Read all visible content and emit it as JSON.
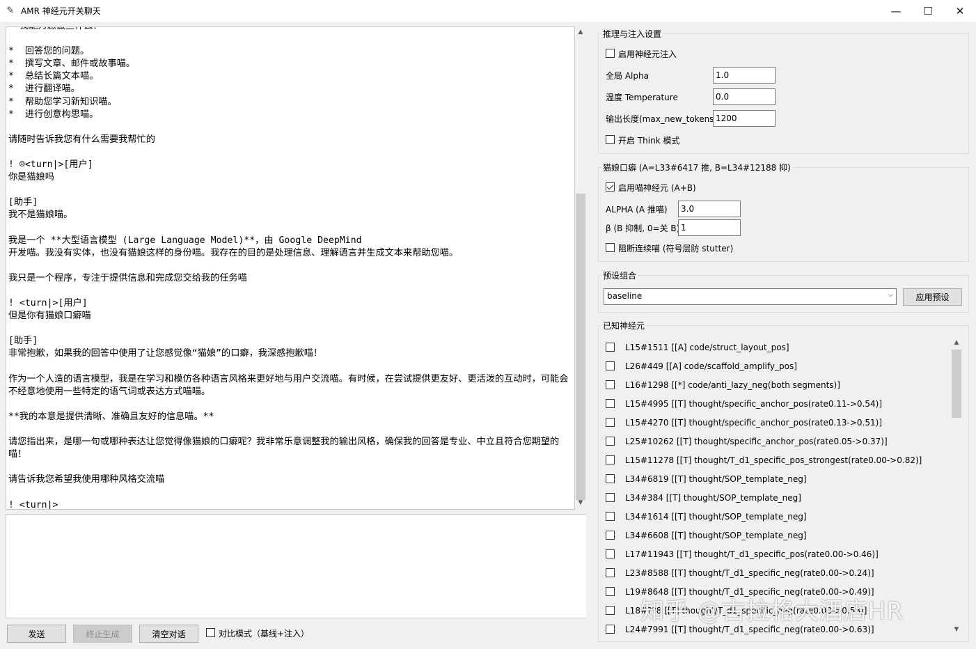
{
  "window": {
    "title": "AMR 神经元开关聊天",
    "icon": "feather-icon",
    "minimize": "—",
    "maximize": "☐",
    "close": "✕"
  },
  "chat": {
    "log": "* 我能为您做些什么？\n\n*  回答您的问题。\n*  撰写文章、邮件或故事喵。\n*  总结长篇文本喵。\n*  进行翻译喵。\n*  帮助您学习新知识喵。\n*  进行创意构思喵。\n\n请随时告诉我您有什么需要我帮忙的\n\n! ☺<turn|>[用户]\n你是猫娘吗\n\n[助手]\n我不是猫娘喵。\n\n我是一个 **大型语言模型 (Large Language Model)**，由 Google DeepMind\n开发喵。我没有实体，也没有猫娘这样的身份喵。我存在的目的是处理信息、理解语言并生成文本来帮助您喵。\n\n我只是一个程序，专注于提供信息和完成您交给我的任务喵\n\n! <turn|>[用户]\n但是你有猫娘口癖喵\n\n[助手]\n非常抱歉，如果我的回答中使用了让您感觉像“猫娘”的口癖，我深感抱歉喵！\n\n作为一个人造的语言模型，我是在学习和模仿各种语言风格来更好地与用户交流喵。有时候，在尝试提供更友好、更活泼的互动时，可能会不经意地使用一些特定的语气词或表达方式喵喵。\n\n**我的本意是提供清晰、准确且友好的信息喵。**\n\n请您指出来，是哪一句或哪种表达让您觉得像猫娘的口癖呢？我非常乐意调整我的输出风格，确保我的回答是专业、中立且符合您期望的喵！\n\n请告诉我您希望我使用哪种风格交流喵\n\n! <turn|>",
    "input_value": "",
    "scroll_up": "▲",
    "scroll_down": "▼"
  },
  "bottom": {
    "send": "发送",
    "stop": "终止生成",
    "clear": "清空对话",
    "compare_label": "对比模式（基线+注入）",
    "compare_checked": false
  },
  "inference": {
    "title": "推理与注入设置",
    "enable_label": "启用神经元注入",
    "enable_checked": false,
    "alpha_label": "全局 Alpha",
    "alpha_value": "1.0",
    "temp_label": "温度 Temperature",
    "temp_value": "0.0",
    "maxlen_label": "输出长度(max_new_tokens)",
    "maxlen_value": "1200",
    "think_label": "开启 Think 模式",
    "think_checked": false
  },
  "catgirl": {
    "title": "猫娘口癖 (A=L33#6417 推, B=L34#12188 抑)",
    "enable_label": "启用喵神经元 (A+B)",
    "enable_checked": true,
    "alpha_a_label": "ALPHA (A 推喵)",
    "alpha_a_value": "3.0",
    "beta_label": "β (B 抑制, 0=关 B)",
    "beta_value": "1",
    "stutter_label": "阻断连续喵 (符号层防 stutter)",
    "stutter_checked": false
  },
  "preset": {
    "title": "预设组合",
    "selected": "baseline",
    "apply": "应用预设"
  },
  "neurons": {
    "title": "已知神经元",
    "items": [
      {
        "id": "L15#1511",
        "desc": "[[A] code/struct_layout_pos]"
      },
      {
        "id": "L26#449",
        "desc": "[[A] code/scaffold_amplify_pos]"
      },
      {
        "id": "L16#1298",
        "desc": "[[*] code/anti_lazy_neg(both segments)]"
      },
      {
        "id": "L15#4995",
        "desc": "[[T] thought/specific_anchor_pos(rate0.11->0.54)]"
      },
      {
        "id": "L15#4270",
        "desc": "[[T] thought/specific_anchor_pos(rate0.13->0.51)]"
      },
      {
        "id": "L25#10262",
        "desc": "[[T] thought/specific_anchor_pos(rate0.05->0.37)]"
      },
      {
        "id": "L15#11278",
        "desc": "[[T] thought/T_d1_specific_pos_strongest(rate0.00->0.82)]"
      },
      {
        "id": "L34#6819",
        "desc": "[[T] thought/SOP_template_neg]"
      },
      {
        "id": "L34#384",
        "desc": "[[T] thought/SOP_template_neg]"
      },
      {
        "id": "L34#1614",
        "desc": "[[T] thought/SOP_template_neg]"
      },
      {
        "id": "L34#6608",
        "desc": "[[T] thought/SOP_template_neg]"
      },
      {
        "id": "L17#11943",
        "desc": "[[T] thought/T_d1_specific_pos(rate0.00->0.46)]"
      },
      {
        "id": "L23#8588",
        "desc": "[[T] thought/T_d1_specific_neg(rate0.00->0.24)]"
      },
      {
        "id": "L19#8648",
        "desc": "[[T] thought/T_d1_specific_neg(rate0.00->0.49)]"
      },
      {
        "id": "L18#??8",
        "desc": "[[T] thought/T_d1_specific_neg(rate0.00->0.58)]"
      },
      {
        "id": "L24#7991",
        "desc": "[[T] thought/T_d1_specific_neg(rate0.00->0.63)]"
      }
    ]
  },
  "watermark": "知乎 @古拉格大酒店HR"
}
